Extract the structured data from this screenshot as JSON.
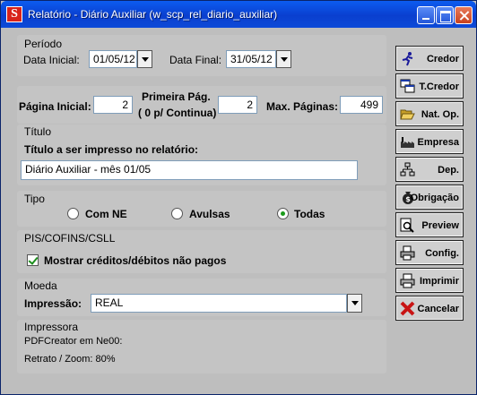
{
  "window": {
    "title": "Relatório - Diário Auxiliar (w_scp_rel_diario_auxiliar)",
    "app_icon_letter": "S"
  },
  "periodo": {
    "title": "Período",
    "data_inicial_label": "Data Inicial:",
    "data_inicial_value": "01/05/12",
    "data_final_label": "Data Final:",
    "data_final_value": "31/05/12"
  },
  "paginas": {
    "pagina_inicial_label": "Página Inicial:",
    "pagina_inicial_value": "2",
    "primeira_pag_label_1": "Primeira Pág.",
    "primeira_pag_label_2": "( 0 p/ Continua)",
    "primeira_pag_value": "2",
    "max_paginas_label": "Max. Páginas:",
    "max_paginas_value": "499"
  },
  "titulo": {
    "title": "Título",
    "field_label": "Título a ser impresso no relatório:",
    "value": "Diário Auxiliar - mês 01/05"
  },
  "tipo": {
    "title": "Tipo",
    "options": [
      "Com NE",
      "Avulsas",
      "Todas"
    ],
    "selected": "Todas"
  },
  "pis": {
    "title": "PIS/COFINS/CSLL",
    "checkbox_label": "Mostrar créditos/débitos não pagos",
    "checked": true
  },
  "moeda": {
    "title": "Moeda",
    "impressao_label": "Impressão:",
    "impressao_value": "REAL"
  },
  "impressora": {
    "title": "Impressora",
    "line1": "PDFCreator em Ne00:",
    "line2": "Retrato / Zoom: 80%"
  },
  "side_buttons": {
    "credor": "Credor",
    "tcredor": "T.Credor",
    "natop": "Nat. Op.",
    "empresa": "Empresa",
    "dep": "Dep.",
    "obrigacao": "Obrigação",
    "preview": "Preview",
    "config": "Config.",
    "imprimir": "Imprimir",
    "cancelar": "Cancelar"
  },
  "colors": {
    "titlebar": "#0a3fcf",
    "window_bg": "#bebebe",
    "radio_dot": "#1b9b1b",
    "cancel_x": "#c81414"
  }
}
